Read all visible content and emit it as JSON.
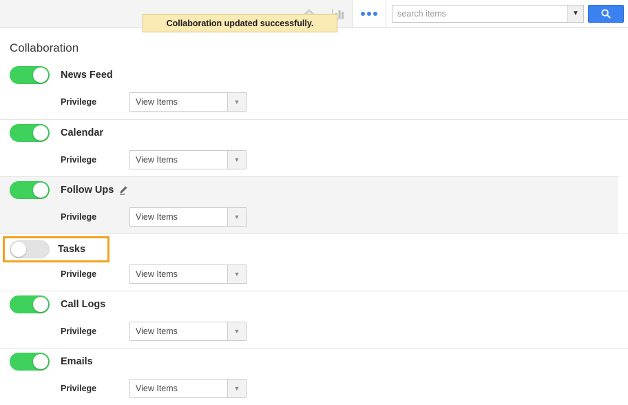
{
  "topbar": {
    "home_icon": "home-icon",
    "chart_icon": "bar-chart-icon",
    "menu_icon": "three-dots-icon",
    "search": {
      "placeholder": "search items",
      "value": "",
      "caret": "▼",
      "button_icon": "search-magnifier-icon"
    }
  },
  "toast": {
    "message": "Collaboration updated successfully.",
    "bg_color": "#faeab4",
    "border_color": "#d9bf77"
  },
  "page": {
    "title": "Collaboration"
  },
  "colors": {
    "toggle_on": "#3ed15c",
    "toggle_off": "#e3e3e3",
    "focus_ring": "#f5a01e",
    "accent_blue": "#3b82f0",
    "hover_row": "#f4f4f4"
  },
  "privilege_label": "Privilege",
  "rows": [
    {
      "name": "News Feed",
      "enabled": true,
      "privilege": "View Items",
      "hover": false,
      "editable": false,
      "focused": false
    },
    {
      "name": "Calendar",
      "enabled": true,
      "privilege": "View Items",
      "hover": false,
      "editable": false,
      "focused": false
    },
    {
      "name": "Follow Ups",
      "enabled": true,
      "privilege": "View Items",
      "hover": true,
      "editable": true,
      "focused": false
    },
    {
      "name": "Tasks",
      "enabled": false,
      "privilege": "View Items",
      "hover": false,
      "editable": false,
      "focused": true
    },
    {
      "name": "Call Logs",
      "enabled": true,
      "privilege": "View Items",
      "hover": false,
      "editable": false,
      "focused": false
    },
    {
      "name": "Emails",
      "enabled": true,
      "privilege": "View Items",
      "hover": false,
      "editable": false,
      "focused": false
    }
  ]
}
